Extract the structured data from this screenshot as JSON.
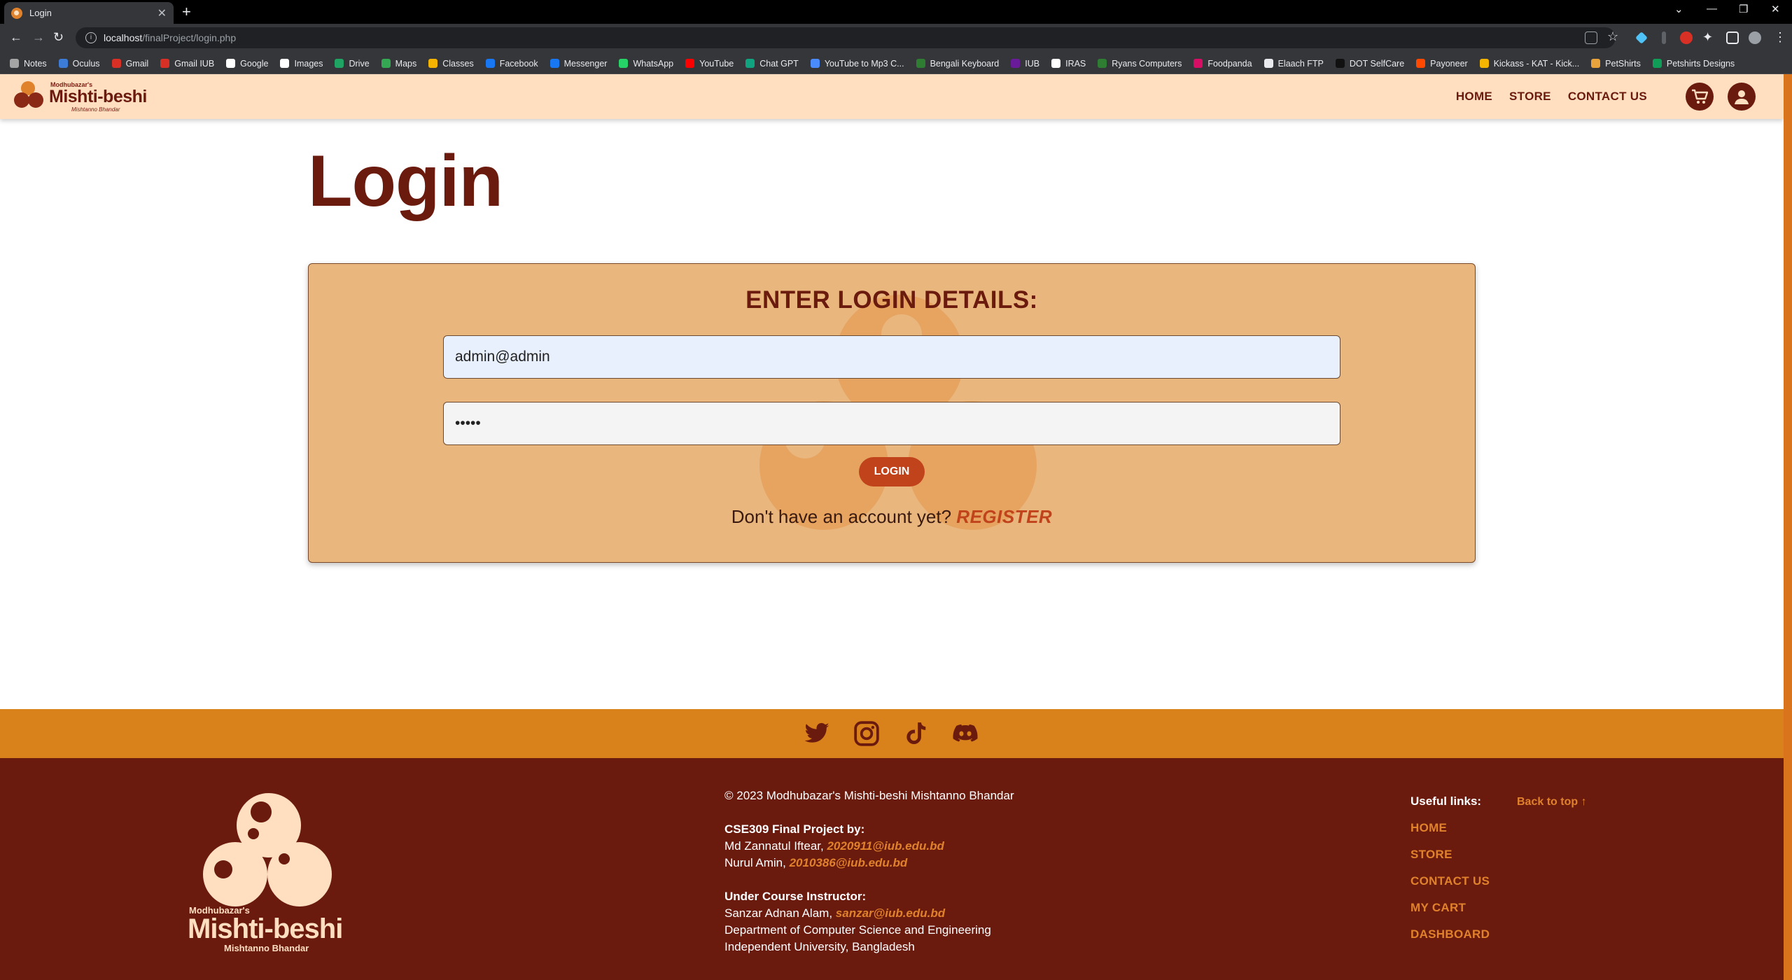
{
  "browser": {
    "tab_title": "Login",
    "tab_close": "✕",
    "new_tab": "+",
    "url_host": "localhost",
    "url_path": "/finalProject/login.php",
    "win_controls": [
      "⌄",
      "—",
      "❐",
      "✕"
    ],
    "bookmarks": [
      {
        "label": "Notes",
        "color": "#a5a5a5"
      },
      {
        "label": "Oculus",
        "color": "#3c7bd6"
      },
      {
        "label": "Gmail",
        "color": "#d93025"
      },
      {
        "label": "Gmail IUB",
        "color": "#d93025"
      },
      {
        "label": "Google",
        "color": "#ffffff"
      },
      {
        "label": "Images",
        "color": "#ffffff"
      },
      {
        "label": "Drive",
        "color": "#1fa463"
      },
      {
        "label": "Maps",
        "color": "#34a853"
      },
      {
        "label": "Classes",
        "color": "#f4b400"
      },
      {
        "label": "Facebook",
        "color": "#1877f2"
      },
      {
        "label": "Messenger",
        "color": "#1877f2"
      },
      {
        "label": "WhatsApp",
        "color": "#25d366"
      },
      {
        "label": "YouTube",
        "color": "#ff0000"
      },
      {
        "label": "Chat GPT",
        "color": "#10a37f"
      },
      {
        "label": "YouTube to Mp3 C...",
        "color": "#4a8cff"
      },
      {
        "label": "Bengali Keyboard",
        "color": "#2e7d32"
      },
      {
        "label": "IUB",
        "color": "#6a1b9a"
      },
      {
        "label": "IRAS",
        "color": "#ffffff"
      },
      {
        "label": "Ryans Computers",
        "color": "#2e7d32"
      },
      {
        "label": "Foodpanda",
        "color": "#d70f64"
      },
      {
        "label": "Elaach FTP",
        "color": "#e8eaed"
      },
      {
        "label": "DOT SelfCare",
        "color": "#111111"
      },
      {
        "label": "Payoneer",
        "color": "#ff4800"
      },
      {
        "label": "Kickass - KAT - Kick...",
        "color": "#f4b400"
      },
      {
        "label": "PetShirts",
        "color": "#e8a33c"
      },
      {
        "label": "Petshirts Designs",
        "color": "#0f9d58"
      }
    ]
  },
  "site": {
    "logo_small": "Modhubazar's",
    "logo_big": "Mishti-beshi",
    "logo_sub": "Mishtanno Bhandar",
    "nav": [
      "HOME",
      "STORE",
      "CONTACT US"
    ],
    "cart_icon": "cart-icon",
    "account_icon": "user-icon",
    "brand_color": "#6b1a0e",
    "accent_color": "#d9811a"
  },
  "login": {
    "page_title": "Login",
    "card_heading": "ENTER LOGIN DETAILS:",
    "email_value": "admin@admin",
    "password_value": "•••••",
    "button_label": "LOGIN",
    "register_prompt": "Don't have an account yet? ",
    "register_link": "REGISTER"
  },
  "footer": {
    "social": [
      "twitter-icon",
      "instagram-icon",
      "tiktok-icon",
      "discord-icon"
    ],
    "logo_small": "Modhubazar's",
    "logo_big": "Mishti-beshi",
    "logo_sub": "Mishtanno Bhandar",
    "copyright": "© 2023 Modhubazar's Mishti-beshi Mishtanno Bhandar",
    "project_heading": "CSE309 Final Project by:",
    "member1_name": "Md Zannatul Iftear, ",
    "member1_email": "2020911@iub.edu.bd",
    "member2_name": "Nurul Amin, ",
    "member2_email": "2010386@iub.edu.bd",
    "instructor_heading": "Under Course Instructor:",
    "instructor_name": "Sanzar Adnan Alam, ",
    "instructor_email": "sanzar@iub.edu.bd",
    "dept": "Department of Computer Science and Engineering",
    "university": "Independent University, Bangladesh",
    "links_heading": "Useful links:",
    "back_to_top": "Back to top ↑",
    "links": [
      "HOME",
      "STORE",
      "CONTACT US",
      "MY CART",
      "DASHBOARD"
    ]
  }
}
